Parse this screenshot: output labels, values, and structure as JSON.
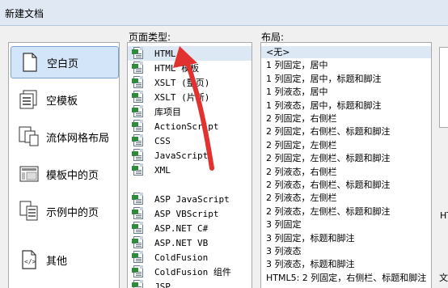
{
  "window": {
    "title": "新建文档"
  },
  "categories": [
    {
      "label": "空白页",
      "icon": "blank-page-icon",
      "selected": true
    },
    {
      "label": "空模板",
      "icon": "template-icon",
      "selected": false
    },
    {
      "label": "流体网格布局",
      "icon": "fluid-grid-icon",
      "selected": false
    },
    {
      "label": "模板中的页",
      "icon": "page-in-template-icon",
      "selected": false
    },
    {
      "label": "示例中的页",
      "icon": "sample-page-icon",
      "selected": false
    },
    {
      "label": "其他",
      "icon": "other-icon",
      "selected": false
    }
  ],
  "page_type": {
    "header": "页面类型:",
    "items": [
      {
        "label": "HTML",
        "selected": true
      },
      {
        "label": "HTML 模板"
      },
      {
        "label": "XSLT (整页)"
      },
      {
        "label": "XSLT (片断)"
      },
      {
        "label": "库项目"
      },
      {
        "label": "ActionScript"
      },
      {
        "label": "CSS"
      },
      {
        "label": "JavaScript"
      },
      {
        "label": "XML"
      },
      {
        "label": "ASP JavaScript"
      },
      {
        "label": "ASP VBScript"
      },
      {
        "label": "ASP.NET C#"
      },
      {
        "label": "ASP.NET VB"
      },
      {
        "label": "ColdFusion"
      },
      {
        "label": "ColdFusion 组件"
      },
      {
        "label": "JSP"
      }
    ]
  },
  "layout": {
    "header": "布局:",
    "items": [
      {
        "label": "<无>",
        "selected": true
      },
      {
        "label": "1 列固定，居中"
      },
      {
        "label": "1 列固定，居中，标题和脚注"
      },
      {
        "label": "1 列液态，居中"
      },
      {
        "label": "1 列液态，居中，标题和脚注"
      },
      {
        "label": "2 列固定，右侧栏"
      },
      {
        "label": "2 列固定，右侧栏、标题和脚注"
      },
      {
        "label": "2 列固定，左侧栏"
      },
      {
        "label": "2 列固定，左侧栏、标题和脚注"
      },
      {
        "label": "2 列液态，右侧栏"
      },
      {
        "label": "2 列液态，右侧栏、标题和脚注"
      },
      {
        "label": "2 列液态，左侧栏"
      },
      {
        "label": "2 列液态，左侧栏、标题和脚注"
      },
      {
        "label": "3 列固定"
      },
      {
        "label": "3 列固定，标题和脚注"
      },
      {
        "label": "3 列液态"
      },
      {
        "label": "3 列液态，标题和脚注"
      },
      {
        "label": "HTML5: 2 列固定，右侧栏、标题和脚注"
      }
    ]
  },
  "side": {
    "text1": "HT",
    "text2": "文"
  }
}
